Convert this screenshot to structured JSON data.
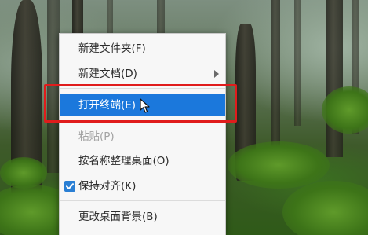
{
  "context_menu": {
    "items": [
      {
        "label": "新建文件夹(F)"
      },
      {
        "label": "新建文档(D)"
      },
      {
        "label": "打开终端(E)"
      },
      {
        "label": "粘贴(P)"
      },
      {
        "label": "按名称整理桌面(O)"
      },
      {
        "label": "保持对齐(K)"
      },
      {
        "label": "更改桌面背景(B)"
      }
    ],
    "active_label": "打开终端(E)",
    "keep_aligned_checked": true
  },
  "icons": {
    "submenu": "chevron-right-icon",
    "check": "checkbox-checked-icon",
    "cursor": "mouse-pointer-icon"
  },
  "colors": {
    "menu_background": "#f7f7f7",
    "active_background": "#1b78dc",
    "active_text": "#ffffff",
    "disabled_text": "#a3a3a3",
    "highlight_border": "#e01c1c",
    "checkbox": "#2a7fd4"
  }
}
